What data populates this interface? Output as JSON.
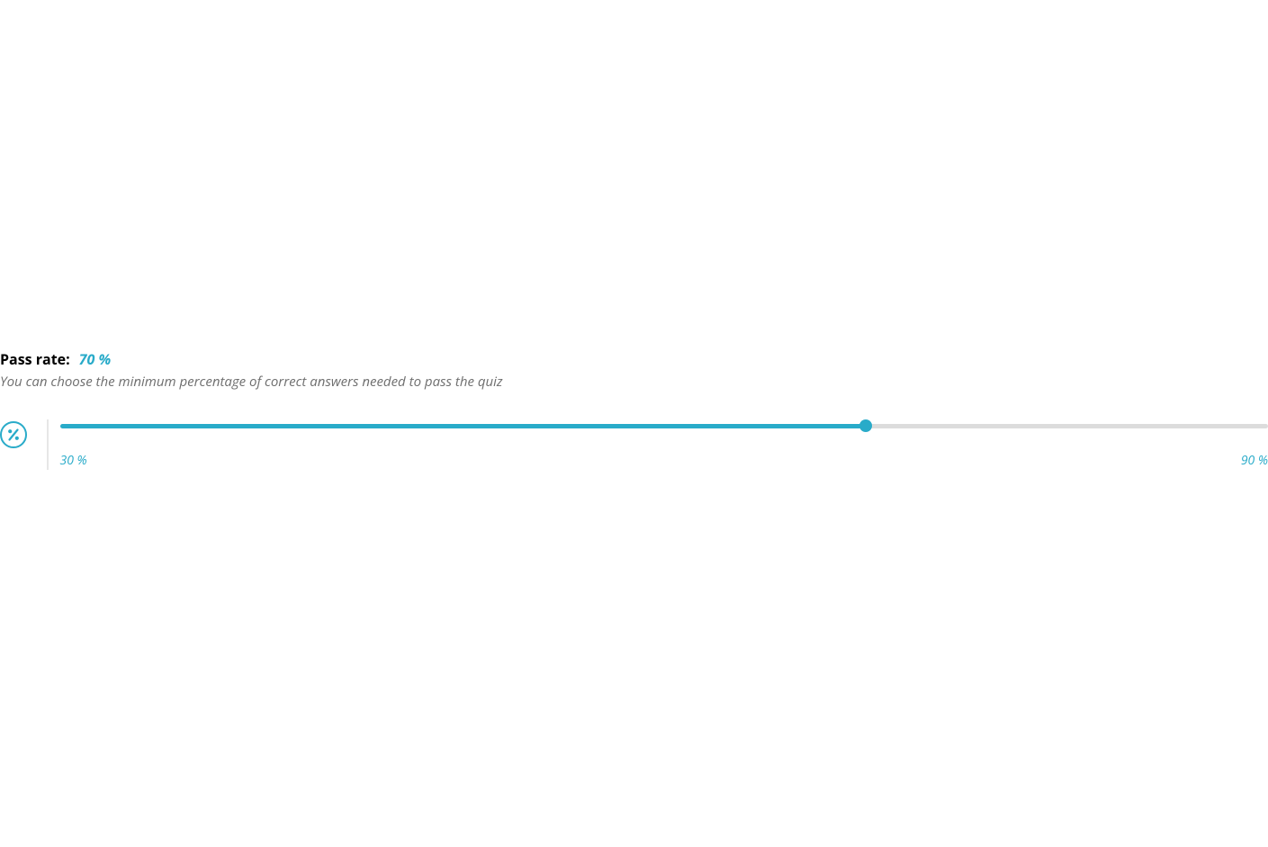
{
  "passRate": {
    "label": "Pass rate:",
    "valueDisplay": "70 %",
    "description": "You can choose the minimum percentage of correct answers needed to pass the quiz",
    "slider": {
      "min": 30,
      "max": 90,
      "value": 70,
      "minLabel": "30 %",
      "maxLabel": "90 %",
      "fillPercent": "66.6667%"
    },
    "accentColor": "#29abc9"
  }
}
